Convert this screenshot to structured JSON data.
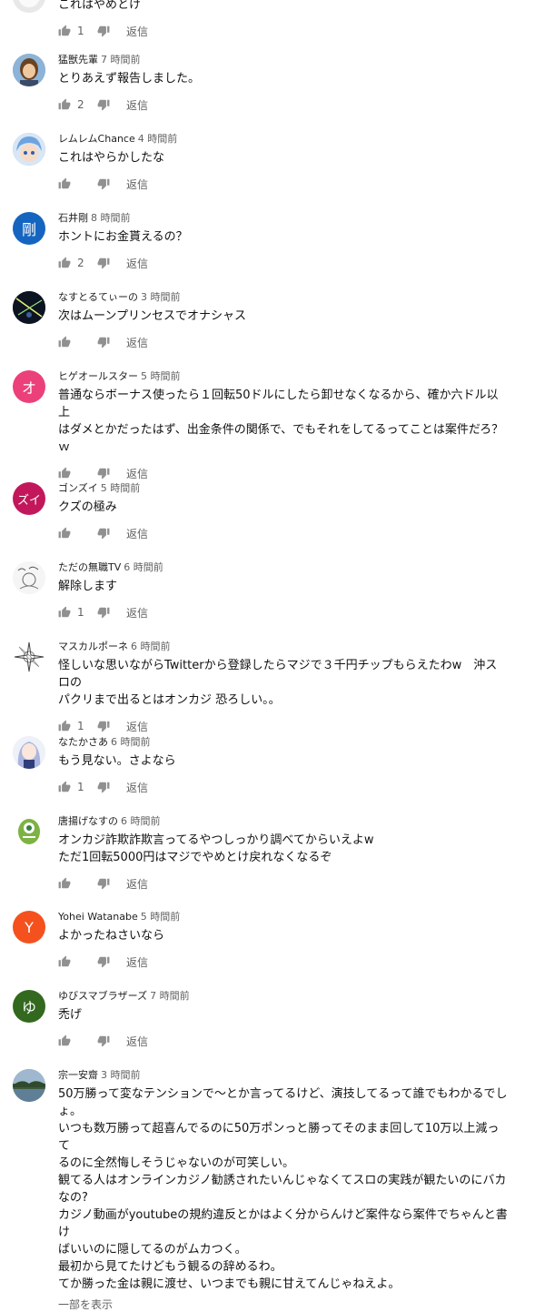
{
  "reply_label": "返信",
  "show_more_label": "一部を表示",
  "comments": [
    {
      "author": "",
      "time": "",
      "text": "これはやめとけ",
      "likes": "1",
      "avatar": {
        "kind": "photo-cat",
        "letter": "",
        "color": "#d9d9d9"
      }
    },
    {
      "author": "猛獣先輩",
      "time": "7 時間前",
      "text": "とりあえず報告しました。",
      "likes": "2",
      "avatar": {
        "kind": "photo-person",
        "letter": "",
        "color": "#b07a4c"
      }
    },
    {
      "author": "レムレムChance",
      "time": "4 時間前",
      "text": "これはやらかしたな",
      "likes": "",
      "avatar": {
        "kind": "photo-anime-blue",
        "letter": "",
        "color": "#7ea9d8"
      }
    },
    {
      "author": "石井剛",
      "time": "8 時間前",
      "text": "ホントにお金貰えるの？",
      "likes": "2",
      "avatar": {
        "kind": "letter",
        "letter": "剛",
        "color": "#1565c0"
      }
    },
    {
      "author": "なすとるてぃーの",
      "time": "3 時間前",
      "text": "次はムーンプリンセスでオナシャス",
      "likes": "",
      "avatar": {
        "kind": "photo-dark",
        "letter": "",
        "color": "#101828"
      }
    },
    {
      "author": "ヒゲオールスター",
      "time": "5 時間前",
      "text": "普通ならボーナス使ったら１回転50ドルにしたら卸せなくなるから、確か六ドル以上\nはダメとかだったはず、出金条件の関係で、でもそれをしてるってことは案件だろ？\nｗ",
      "likes": "",
      "avatar": {
        "kind": "letter",
        "letter": "オ",
        "color": "#ec407a"
      }
    },
    {
      "author": "ゴンズイ",
      "time": "5 時間前",
      "text": "クズの極み",
      "likes": "",
      "avatar": {
        "kind": "letter",
        "letter": "ズイ",
        "color": "#c2185b"
      }
    },
    {
      "author": "ただの無職TV",
      "time": "6 時間前",
      "text": "解除します",
      "likes": "1",
      "avatar": {
        "kind": "photo-sketch",
        "letter": "",
        "color": "#f1f1f1"
      }
    },
    {
      "author": "マスカルポーネ",
      "time": "6 時間前",
      "text": "怪しいな思いながらTwitterから登録したらマジで３千円チップもらえたわw　沖スロの\nパクリまで出るとはオンカジ 恐ろしい。。",
      "likes": "1",
      "avatar": {
        "kind": "photo-compass",
        "letter": "",
        "color": "#ffffff"
      }
    },
    {
      "author": "なたかさあ",
      "time": "6 時間前",
      "text": "もう見ない。さよなら",
      "likes": "1",
      "avatar": {
        "kind": "photo-anime-girl",
        "letter": "",
        "color": "#e8ecf5"
      }
    },
    {
      "author": "唐揚げなすの",
      "time": "6 時間前",
      "text": "オンカジ詐欺詐欺言ってるやつしっかり調べてからいえよw\nただ1回転5000円はマジでやめとけ戻れなくなるぞ",
      "likes": "",
      "avatar": {
        "kind": "photo-monster",
        "letter": "",
        "color": "#7cb342"
      }
    },
    {
      "author": "Yohei Watanabe",
      "time": "5 時間前",
      "text": "よかったねさいなら",
      "likes": "",
      "avatar": {
        "kind": "letter",
        "letter": "Y",
        "color": "#f4511e"
      }
    },
    {
      "author": "ゆびスマブラザーズ",
      "time": "7 時間前",
      "text": "禿げ",
      "likes": "",
      "avatar": {
        "kind": "letter",
        "letter": "ゆ",
        "color": "#33691e"
      }
    },
    {
      "author": "宗一安齋",
      "time": "3 時間前",
      "text": "50万勝って変なテンションで〜とか言ってるけど、演技してるって誰でもわかるでし\nょ。\nいつも数万勝って超喜んでるのに50万ポンっと勝ってそのまま回して10万以上減って\nるのに全然悔しそうじゃないのが可笑しい。\n観てる人はオンラインカジノ勧誘されたいんじゃなくてスロの実践が観たいのにバカ\nなの?\nカジノ動画がyoutubeの規約違反とかはよく分からんけど案件なら案件でちゃんと書け\nばいいのに隠してるのがムカつく。\n最初から見てたけどもう観るの辞めるわ。\nてか勝った金は親に渡せ、いつまでも親に甘えてんじゃねえよ。",
      "likes": "",
      "avatar": {
        "kind": "photo-landscape",
        "letter": "",
        "color": "#5d7a91"
      }
    }
  ]
}
